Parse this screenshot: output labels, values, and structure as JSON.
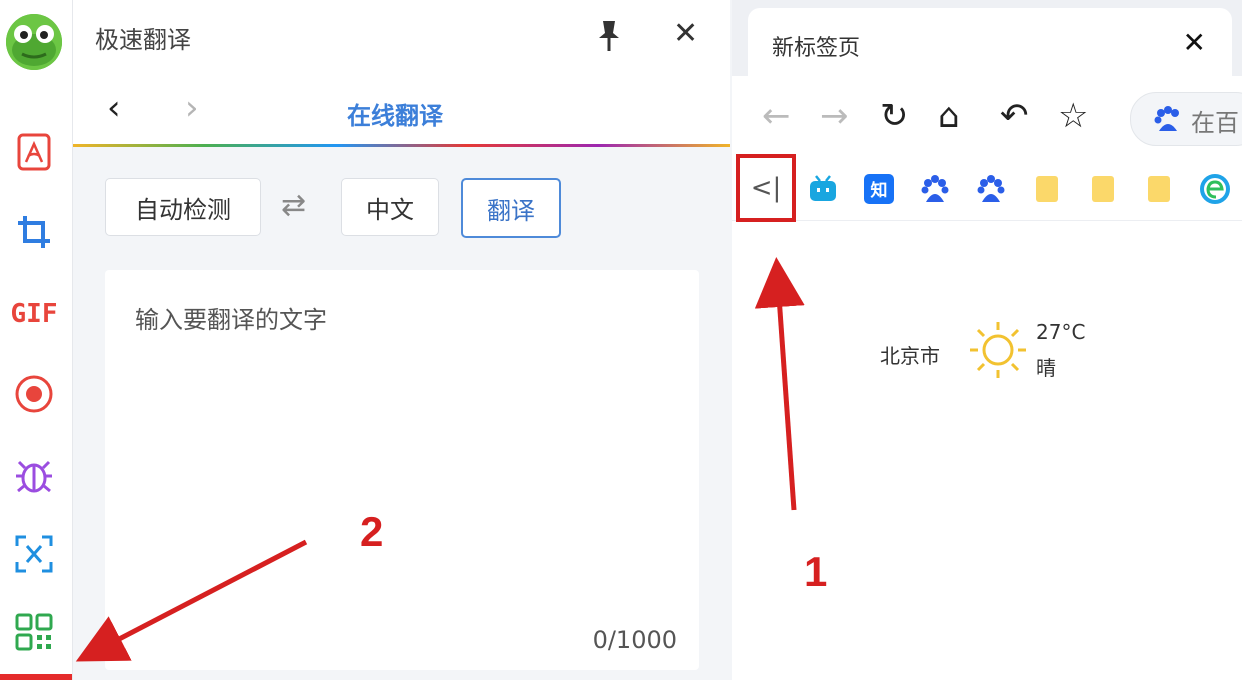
{
  "toolbar": {
    "tools": [
      "pdf-icon",
      "crop-icon",
      "gif",
      "record-icon",
      "bug-icon",
      "text-scan-icon",
      "qr-icon"
    ],
    "gif_label": "GIF"
  },
  "panel": {
    "title": "极速翻译",
    "nav_title": "在线翻译",
    "source_lang": "自动检测",
    "target_lang": "中文",
    "translate_button": "翻译",
    "placeholder": "输入要翻译的文字",
    "counter": "0/1000"
  },
  "browser": {
    "tab_title": "新标签页",
    "address_text": "在百",
    "collapse_label": "<|",
    "weather": {
      "city": "北京市",
      "temp": "27°C",
      "condition": "晴"
    }
  },
  "annotations": {
    "label_1": "1",
    "label_2": "2",
    "color": "#d62020"
  },
  "colors": {
    "accent": "#3c7fd9",
    "annotation": "#d62020"
  }
}
